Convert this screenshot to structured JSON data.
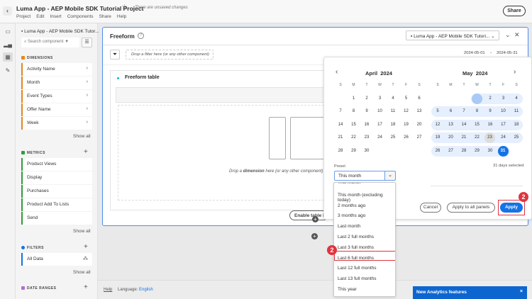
{
  "header": {
    "title": "Luma App - AEP Mobile SDK Tutorial Project",
    "unsaved": "There are unsaved changes",
    "menu": [
      "Project",
      "Edit",
      "Insert",
      "Components",
      "Share",
      "Help"
    ],
    "share": "Share"
  },
  "sidebar": {
    "suite": "Luma App - AEP Mobile SDK Tutor...",
    "search_placeholder": "Search component",
    "dimensions": {
      "title": "DIMENSIONS",
      "color": "#e68619",
      "items": [
        "Activity Name",
        "Month",
        "Event Types",
        "Offer Name",
        "Week"
      ],
      "show_all": "Show all"
    },
    "metrics": {
      "title": "METRICS",
      "color": "#2d9d3a",
      "items": [
        "Product Views",
        "Display",
        "Purchases",
        "Product Add To Lists",
        "Send"
      ],
      "show_all": "Show all"
    },
    "filters": {
      "title": "FILTERS",
      "color": "#1473e6",
      "items": [
        "All Data"
      ],
      "show_all": "Show all"
    },
    "date_ranges": {
      "title": "DATE RANGES",
      "color": "#b66cd3"
    }
  },
  "panel": {
    "title": "Freeform",
    "filter_drop": "Drop a filter here (or any other component)",
    "date_start": "2024-05-01",
    "date_sep": "-",
    "date_end": "2024-05-31",
    "suite": "Luma App - AEP Mobile SDK Tutori...",
    "table_title": "Freeform table",
    "drop_dim_pre": "Drop a ",
    "drop_dim_bold": "dimension",
    "drop_dim_post": " here (or any other component)",
    "enable_button": "Enable table builder"
  },
  "calendar": {
    "weekdays": [
      "S",
      "M",
      "T",
      "W",
      "T",
      "F",
      "S"
    ],
    "months": [
      {
        "name": "April",
        "year": "2024",
        "weeks": [
          [
            "",
            "1",
            "2",
            "3",
            "4",
            "5",
            "6"
          ],
          [
            "7",
            "8",
            "9",
            "10",
            "11",
            "12",
            "13"
          ],
          [
            "14",
            "15",
            "16",
            "17",
            "18",
            "19",
            "20"
          ],
          [
            "21",
            "22",
            "23",
            "24",
            "25",
            "26",
            "27"
          ],
          [
            "28",
            "29",
            "30",
            "",
            "",
            "",
            ""
          ]
        ]
      },
      {
        "name": "May",
        "year": "2024",
        "weeks": [
          [
            "",
            "",
            "",
            "1",
            "2",
            "3",
            "4"
          ],
          [
            "5",
            "6",
            "7",
            "8",
            "9",
            "10",
            "11"
          ],
          [
            "12",
            "13",
            "14",
            "15",
            "16",
            "17",
            "18"
          ],
          [
            "19",
            "20",
            "21",
            "22",
            "23",
            "24",
            "25"
          ],
          [
            "26",
            "27",
            "28",
            "29",
            "30",
            "31",
            ""
          ]
        ]
      }
    ],
    "range_start": "1",
    "range_end": "31",
    "today": "23",
    "preset_label": "Preset",
    "preset_value": "This month",
    "days_selected": "31 days selected",
    "cancel": "Cancel",
    "apply_all": "Apply to all panels",
    "apply": "Apply",
    "preset_options": [
      "This month",
      "This month (excluding today)",
      "2 months ago",
      "3 months ago",
      "Last month",
      "Last 2 full months",
      "Last 3 full months",
      "Last 6 full months",
      "Last 12 full months",
      "Last 13 full months",
      "This year"
    ]
  },
  "callouts": {
    "apply_step": "2",
    "option_step": "2"
  },
  "footer": {
    "help": "Help",
    "language_label": "Language: ",
    "language": "English"
  },
  "notification": {
    "text": "New Analytics features",
    "close": "×"
  }
}
